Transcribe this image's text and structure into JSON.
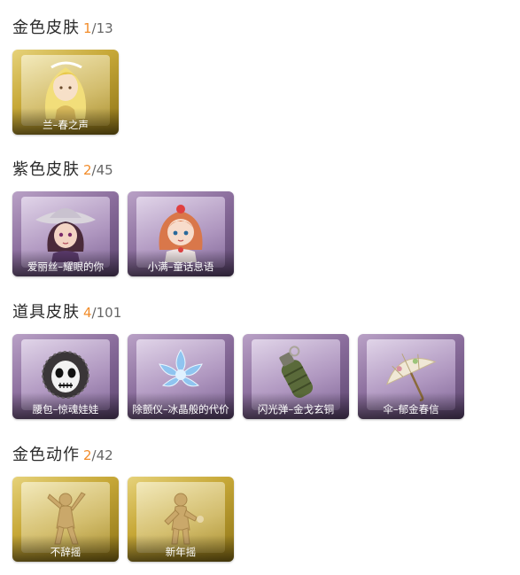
{
  "sections": [
    {
      "name": "金色皮肤",
      "owned": "1",
      "total": "/13",
      "items": [
        {
          "label": "兰–春之声",
          "rarity": "gold",
          "icon": "blonde-character-portrait"
        }
      ]
    },
    {
      "name": "紫色皮肤",
      "owned": "2",
      "total": "/45",
      "items": [
        {
          "label": "爱丽丝–耀眼的你",
          "rarity": "purple",
          "icon": "cowboy-hat-girl-portrait"
        },
        {
          "label": "小满–童话息语",
          "rarity": "purple",
          "icon": "red-hair-girl-portrait"
        }
      ]
    },
    {
      "name": "道具皮肤",
      "owned": "4",
      "total": "/101",
      "items": [
        {
          "label": "腰包–惊魂娃娃",
          "rarity": "purple",
          "icon": "skull-doll-bag-icon"
        },
        {
          "label": "除颤仪–冰晶般的代价",
          "rarity": "purple",
          "icon": "ice-crystal-flower-icon"
        },
        {
          "label": "闪光弹–金戈玄铜",
          "rarity": "purple",
          "icon": "grenade-icon"
        },
        {
          "label": "伞–郁金春信",
          "rarity": "purple",
          "icon": "umbrella-icon"
        }
      ]
    },
    {
      "name": "金色动作",
      "owned": "2",
      "total": "/42",
      "items": [
        {
          "label": "不辞摇",
          "rarity": "gold",
          "icon": "dance-pose-icon"
        },
        {
          "label": "新年摇",
          "rarity": "gold",
          "icon": "celebrate-pose-icon"
        }
      ]
    }
  ],
  "colors": {
    "owned": "#f28c2a",
    "gold": "#c7a838",
    "purple": "#8a6d9c"
  }
}
